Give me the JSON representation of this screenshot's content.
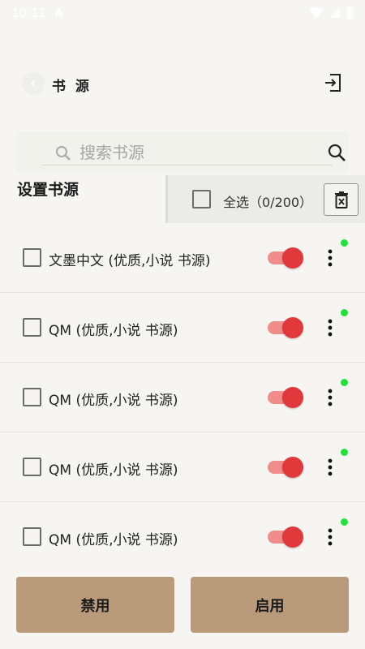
{
  "status_bar": {
    "time": "10:11",
    "app_icon": "A",
    "icons": [
      "wifi-icon",
      "signal-icon",
      "battery-icon"
    ]
  },
  "header": {
    "title": "书 源",
    "back_icon": "chevron-left-icon",
    "import_icon": "import-icon"
  },
  "search": {
    "placeholder": "搜索书源",
    "icon": "search-icon"
  },
  "section": {
    "title": "设置书源"
  },
  "selection": {
    "select_all_label": "全选（0/200）",
    "delete_icon": "delete-icon"
  },
  "sources": [
    {
      "label": "文墨中文 (优质,小说 书源)",
      "checked": false,
      "enabled": true,
      "status": "online"
    },
    {
      "label": "QM (优质,小说 书源)",
      "checked": false,
      "enabled": true,
      "status": "online"
    },
    {
      "label": "QM (优质,小说 书源)",
      "checked": false,
      "enabled": true,
      "status": "online"
    },
    {
      "label": "QM (优质,小说 书源)",
      "checked": false,
      "enabled": true,
      "status": "online"
    },
    {
      "label": "QM (优质,小说 书源)",
      "checked": false,
      "enabled": true,
      "status": "online"
    }
  ],
  "actions": {
    "disable_label": "禁用",
    "enable_label": "启用"
  },
  "colors": {
    "background": "#f6f5f1",
    "button": "#b99b7b",
    "toggle_on": "#e0383b",
    "toggle_track": "#f08c8a",
    "status_online": "#24e03b"
  }
}
